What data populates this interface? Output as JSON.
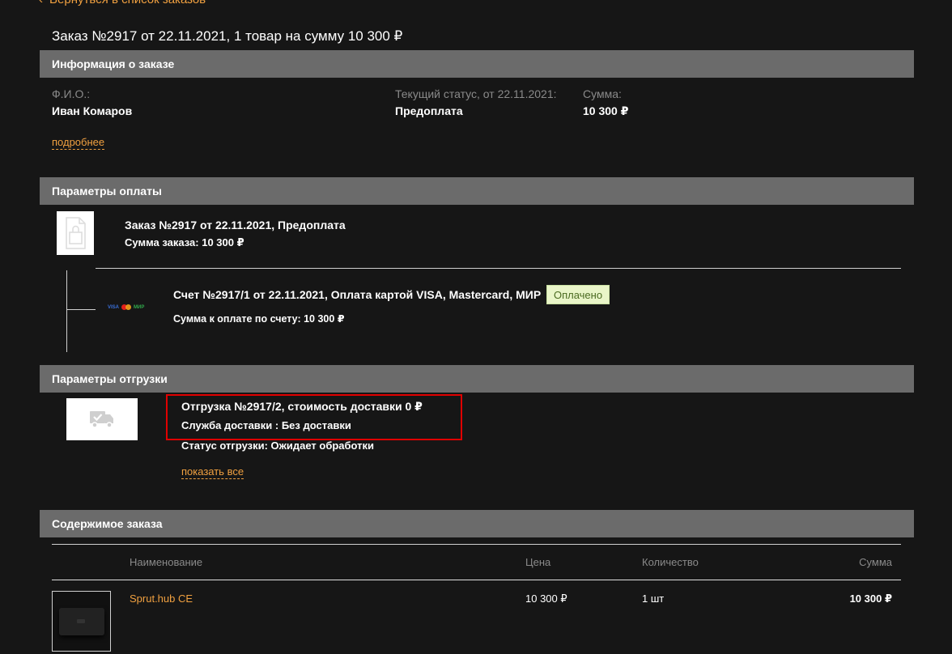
{
  "back_link": {
    "chevron": "‹",
    "label": "Вернуться в список заказов"
  },
  "page_title": "Заказ №2917 от 22.11.2021, 1 товар на сумму 10 300 ₽",
  "order_info": {
    "header": "Информация о заказе",
    "fio_label": "Ф.И.О.:",
    "fio_value": "Иван Комаров",
    "status_label": "Текущий статус, от 22.11.2021:",
    "status_value": "Предоплата",
    "sum_label": "Сумма:",
    "sum_value": "10 300 ₽",
    "more_link": "подробнее"
  },
  "payment": {
    "header": "Параметры оплаты",
    "order_title": "Заказ №2917 от 22.11.2021, Предоплата",
    "order_sum": "Сумма заказа: 10 300 ₽",
    "card_logos": {
      "visa": "VISA",
      "mir": "МИР"
    },
    "invoice_title": "Счет №2917/1 от 22.11.2021, Оплата картой VISA, Mastercard, МИР",
    "invoice_status": "Оплачено",
    "invoice_sum": "Сумма к оплате по счету: 10 300 ₽"
  },
  "shipment": {
    "header": "Параметры отгрузки",
    "title": "Отгрузка №2917/2, стоимость доставки 0 ₽",
    "service": "Служба доставки : Без доставки",
    "status": "Статус отгрузки: Ожидает обработки",
    "show_all_link": "показать все"
  },
  "contents": {
    "header": "Содержимое заказа",
    "columns": {
      "name": "Наименование",
      "price": "Цена",
      "qty": "Количество",
      "sum": "Сумма"
    },
    "rows": [
      {
        "name": "Sprut.hub CE",
        "price": "10 300 ₽",
        "qty": "1 шт",
        "sum": "10 300 ₽"
      }
    ]
  },
  "colors": {
    "background": "#161616",
    "section_header": "#6b6b6b",
    "accent": "#f0a040",
    "highlight_border": "#e00000",
    "paid_badge_bg": "#e9f5c8"
  }
}
